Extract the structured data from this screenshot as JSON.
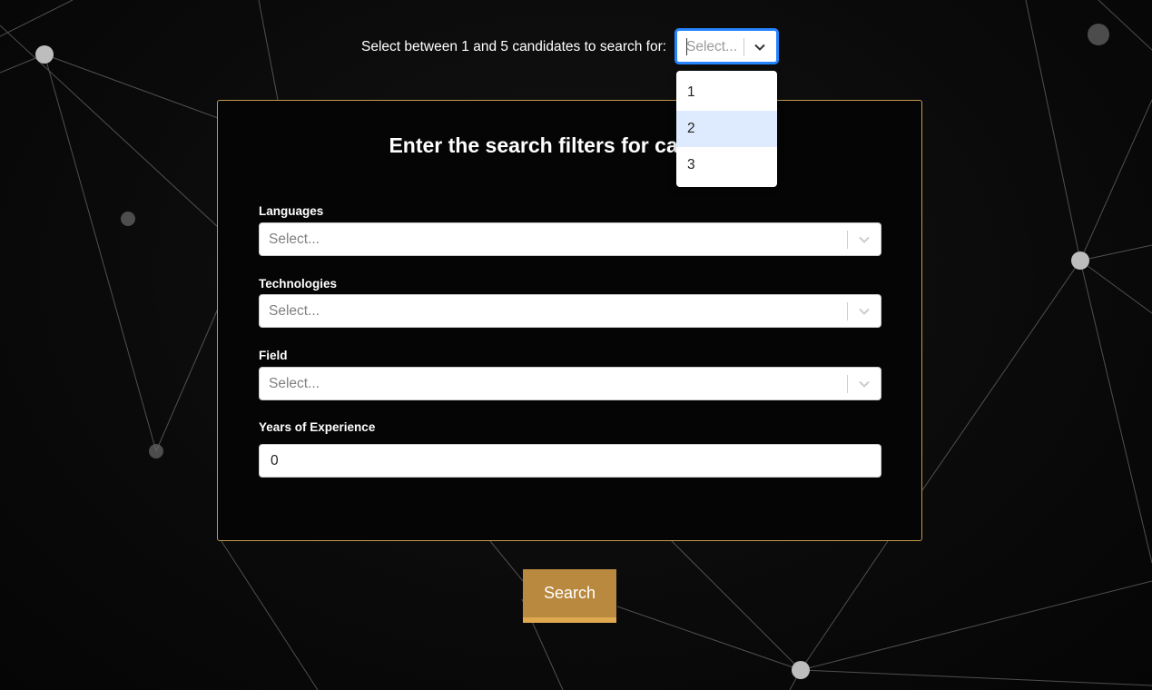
{
  "candidate_count": {
    "label": "Select between 1 and 5 candidates to search for:",
    "placeholder": "Select...",
    "options": [
      "1",
      "2",
      "3"
    ],
    "highlighted_option": "2"
  },
  "filters": {
    "title": "Enter the search filters for candidate",
    "languages": {
      "label": "Languages",
      "placeholder": "Select..."
    },
    "technologies": {
      "label": "Technologies",
      "placeholder": "Select..."
    },
    "field": {
      "label": "Field",
      "placeholder": "Select..."
    },
    "experience": {
      "label": "Years of Experience",
      "value": "0"
    }
  },
  "search_button": "Search",
  "colors": {
    "accent": "#b9893f",
    "accent_border": "#e0a84f",
    "focus_blue": "#2684ff",
    "option_highlight": "#deebff"
  },
  "icons": {
    "dropdown": "chevron-down-icon",
    "background": "network-graph"
  }
}
